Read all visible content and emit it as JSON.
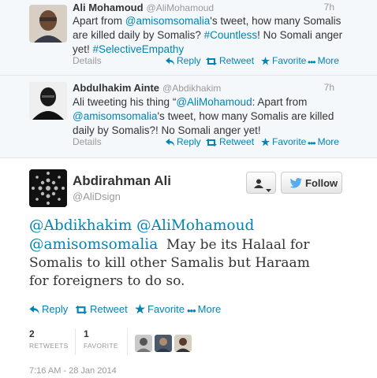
{
  "tweets": [
    {
      "name": "Ali Mohamoud",
      "handle": "@AliMohamoud",
      "time": "7h",
      "text_parts": [
        {
          "t": "Apart from ",
          "link": false
        },
        {
          "t": "@amisomsomalia",
          "link": true
        },
        {
          "t": "'s tweet, how many Somalis are killed daily by Somalis? ",
          "link": false
        },
        {
          "t": "#Countless",
          "link": true
        },
        {
          "t": "! No Somali anger yet! ",
          "link": false
        },
        {
          "t": "#SelectiveEmpathy",
          "link": true
        }
      ]
    },
    {
      "name": "Abdulhakim Ainte",
      "handle": "@Abdikhakim",
      "time": "7h",
      "text_parts": [
        {
          "t": "Ali tweeting his thing “",
          "link": false
        },
        {
          "t": "@AliMohamoud",
          "link": true
        },
        {
          "t": ": Apart from ",
          "link": false
        },
        {
          "t": "@amisomsomalia",
          "link": true
        },
        {
          "t": "'s tweet, how many Somalis are killed daily by Somalis?! No Somali anger yet!",
          "link": false
        }
      ]
    }
  ],
  "actions": {
    "details": "Details",
    "reply": "Reply",
    "retweet": "Retweet",
    "favorite": "Favorite",
    "more": "More"
  },
  "main": {
    "name": "Abdirahman Ali",
    "handle": "@AliDsign",
    "follow_label": "Follow",
    "text_mentions": "@Abdikhakim @AliMohamoud @amisomsomalia",
    "text_body_1": "May be its Halaal for",
    "text_body_2": "Somalis to kill other Samalis but Haraam",
    "text_body_3": "for foreigners to do so.",
    "retweets_count": "2",
    "retweets_label": "RETWEETS",
    "favorites_count": "1",
    "favorites_label": "FAVORITE",
    "timestamp": "7:16 AM - 28 Jan 2014"
  },
  "colors": {
    "link": "#0084b4",
    "follow_bird": "#55acee"
  }
}
